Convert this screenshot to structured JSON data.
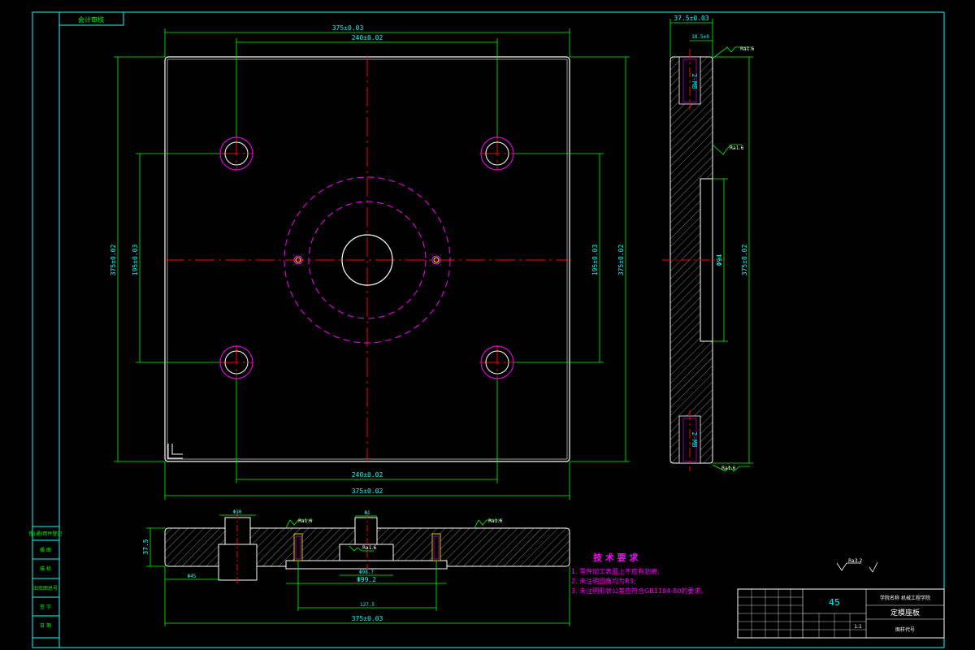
{
  "drawing": {
    "corner_tag": "会计审核",
    "top_view": {
      "dim_overall_width": "375±0.03",
      "dim_hole_spacing_x_top": "240±0.02",
      "dim_hole_spacing_x_bottom": "240±0.02",
      "dim_overall_width_bottom": "375±0.02",
      "dim_left_outer": "375±0.02",
      "dim_left_inner": "195±0.03",
      "dim_right_inner": "195±0.03",
      "dim_right_outer": "375±0.02"
    },
    "side_view": {
      "dim_thickness": "37.5±0.03",
      "dim_top_hole": "18.5±0",
      "thread_top": "2-M8",
      "thread_bottom": "2-M8",
      "dim_slot": "Φ94",
      "dim_height": "375±0.02",
      "rough_top": "Ra1.6",
      "rough_mid": "Ra1.6",
      "rough_bottom": "Ra1.6"
    },
    "section_view": {
      "dim_hole": "Φ30",
      "dim_thickness": "37.5",
      "dim_counterbore": "Φ45",
      "dim_center_top": "Φ1",
      "rough_left": "Ra1.6",
      "rough_center": "Ra1.6",
      "rough_right": "Ra1.6",
      "dim_a": "Φ98.7",
      "dim_b": "Φ99.2",
      "dim_c": "127.5",
      "dim_overall": "375±0.03"
    },
    "tech_req": {
      "title": "技 术 要 求",
      "line1": "1. 零件加工表面上不应有划痕;",
      "line2": "2. 未注明圆角均为R3;",
      "line3": "3. 未注明形状公差应符合GB1184-80的要求。"
    },
    "surface_note": "Ra3.2",
    "title_block": {
      "material": "45",
      "school": "学院名称 机械工程学院",
      "part_name": "定模座板",
      "drawing_no": "图样代号",
      "scale": "1:1"
    },
    "left_strip": [
      "借(通)用件登记",
      "描 图",
      "描 校",
      "旧底图总号",
      "签 字",
      "日 期"
    ]
  },
  "colors": {
    "outline": "#ffffff",
    "dimension": "#00ff00",
    "dimension_text": "#00ffff",
    "centerline": "#ff0000",
    "hidden": "#ff00ff",
    "hatch": "#7f7f7f"
  }
}
